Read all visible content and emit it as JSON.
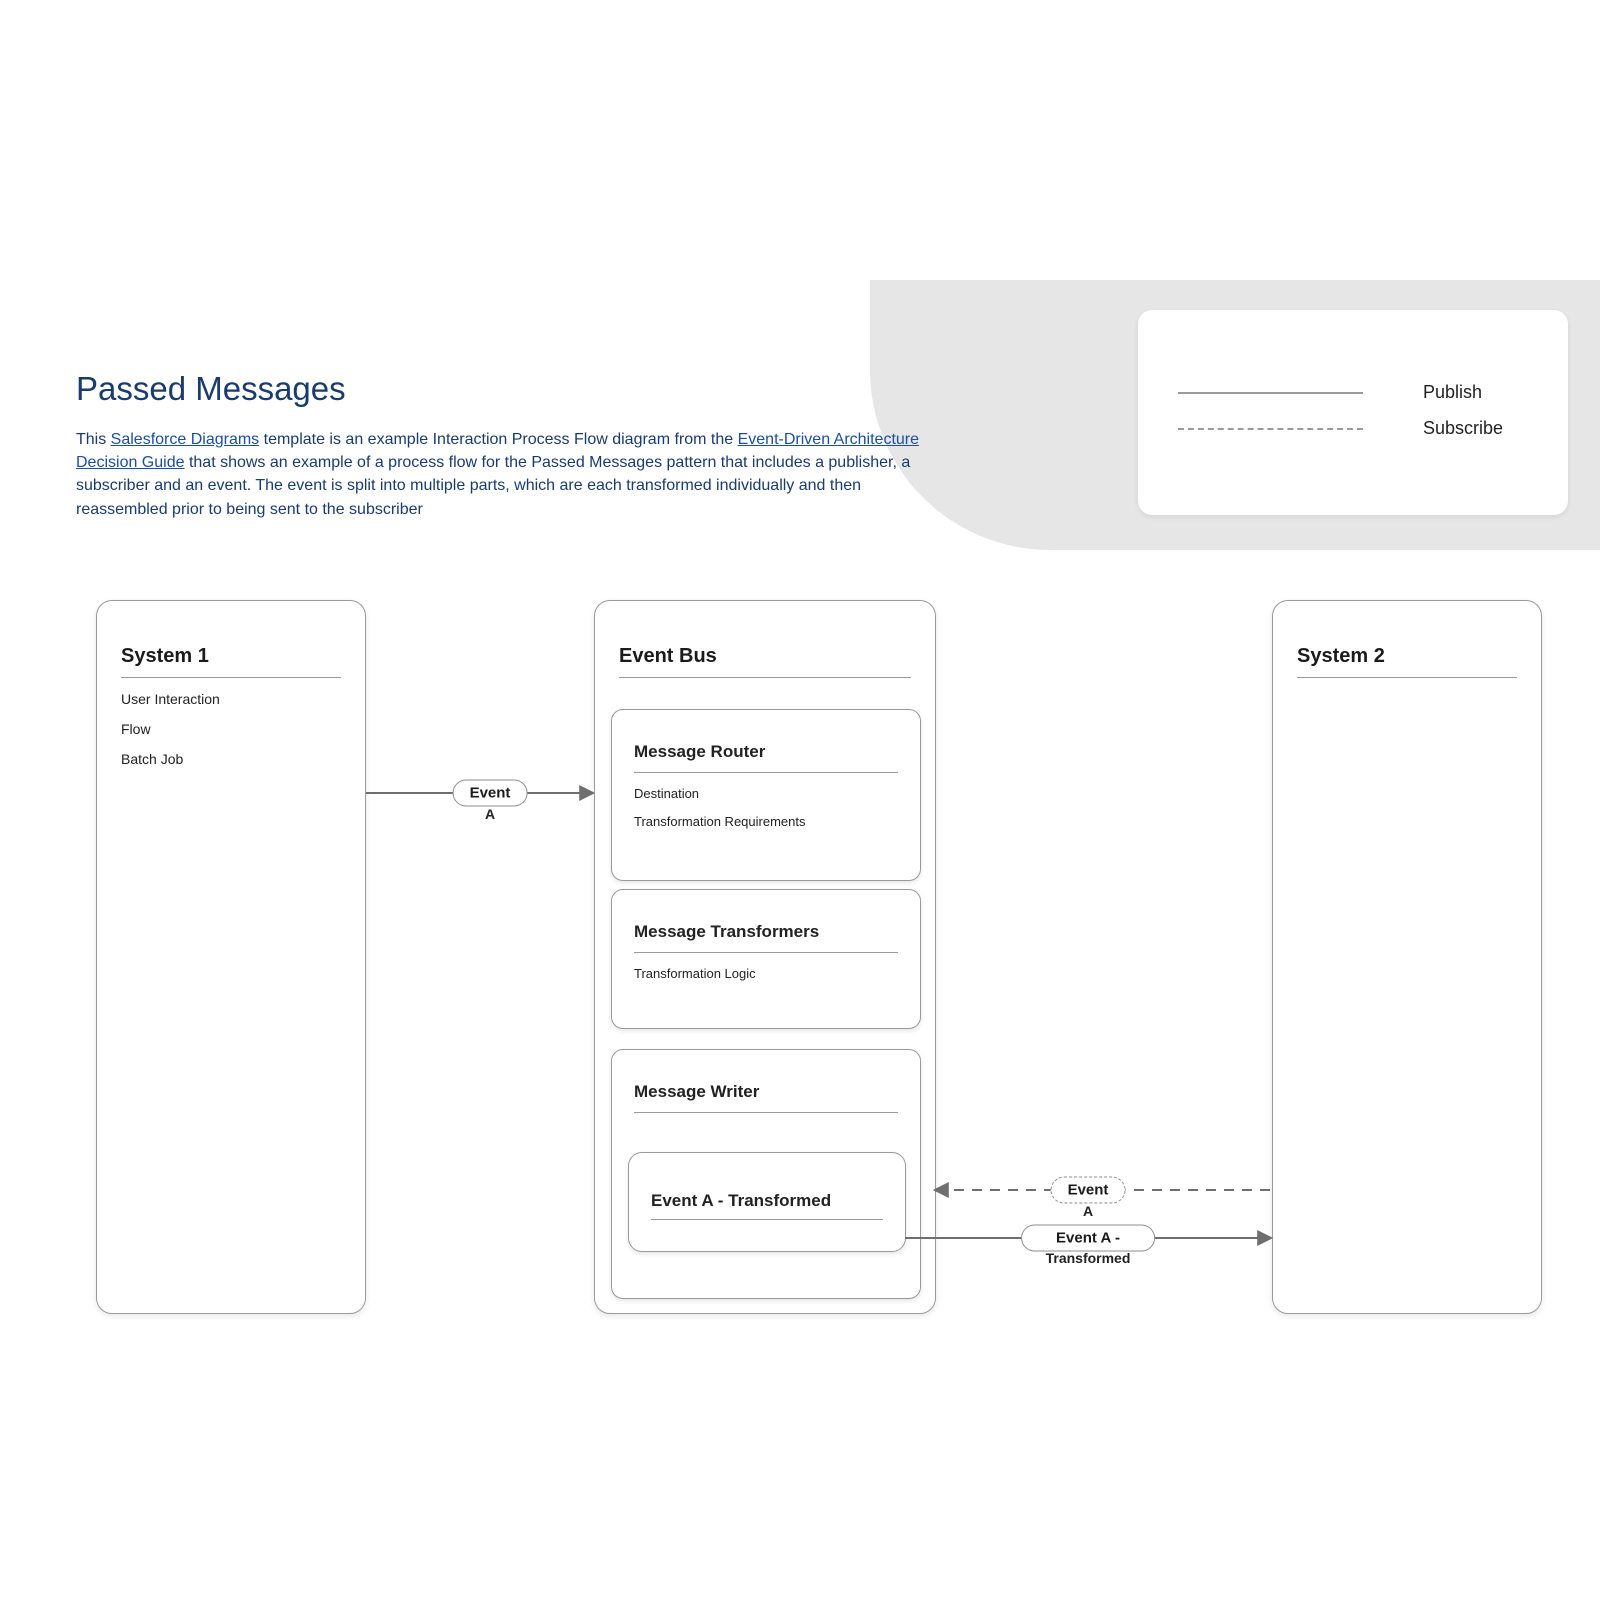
{
  "header": {
    "title": "Passed Messages",
    "desc_pre": "This ",
    "link1": "Salesforce Diagrams",
    "desc_mid": " template is an example Interaction Process Flow diagram from the ",
    "link2": "Event-Driven Architecture Decision Guide",
    "desc_post": " that shows an example of a process flow for the Passed Messages pattern that includes a publisher, a subscriber and an event.  The event is split into multiple parts, which are each transformed individually and then reassembled prior to being sent to the subscriber"
  },
  "legend": {
    "publish": "Publish",
    "subscribe": "Subscribe"
  },
  "lanes": {
    "system1": {
      "title": "System 1",
      "items": [
        "User Interaction",
        "Flow",
        "Batch Job"
      ]
    },
    "event_bus": {
      "title": "Event Bus",
      "router": {
        "title": "Message Router",
        "items": [
          "Destination",
          "Transformation Requirements"
        ]
      },
      "transformers": {
        "title": "Message Transformers",
        "items": [
          "Transformation Logic"
        ]
      },
      "writer": {
        "title": "Message Writer",
        "inner_event": "Event A - Transformed"
      }
    },
    "system2": {
      "title": "System 2"
    }
  },
  "events": {
    "a": "Event",
    "a_sub": "A",
    "a_sub2": "A",
    "transformed": "Event A -",
    "transformed_sub": "Transformed"
  }
}
